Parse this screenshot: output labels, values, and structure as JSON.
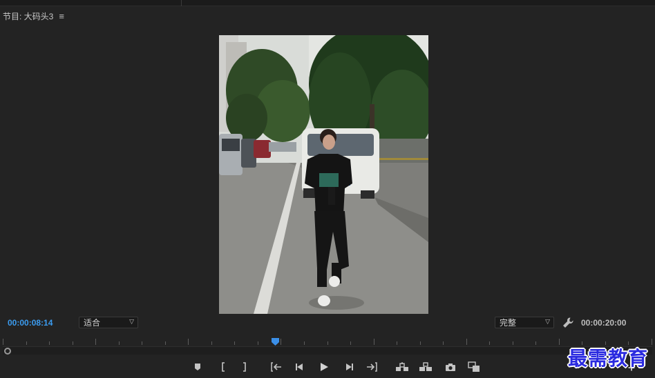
{
  "panel": {
    "title": "节目: 大码头3"
  },
  "controls": {
    "current_timecode": "00:00:08:14",
    "duration_timecode": "00:00:20:00",
    "zoom_dropdown": {
      "selected": "适合"
    },
    "quality_dropdown": {
      "selected": "完整"
    }
  },
  "playback": {
    "playhead_fraction": 0.42
  },
  "transport_buttons": [
    "add-marker",
    "mark-in",
    "mark-out",
    "go-to-in",
    "step-back",
    "play",
    "step-forward",
    "go-to-out",
    "lift",
    "extract",
    "export-frame",
    "comparison-view"
  ],
  "watermark": {
    "text": "最需教育"
  },
  "colors": {
    "background": "#232323",
    "timecode_accent": "#3b9cf0",
    "watermark": "#2a2ae0"
  }
}
